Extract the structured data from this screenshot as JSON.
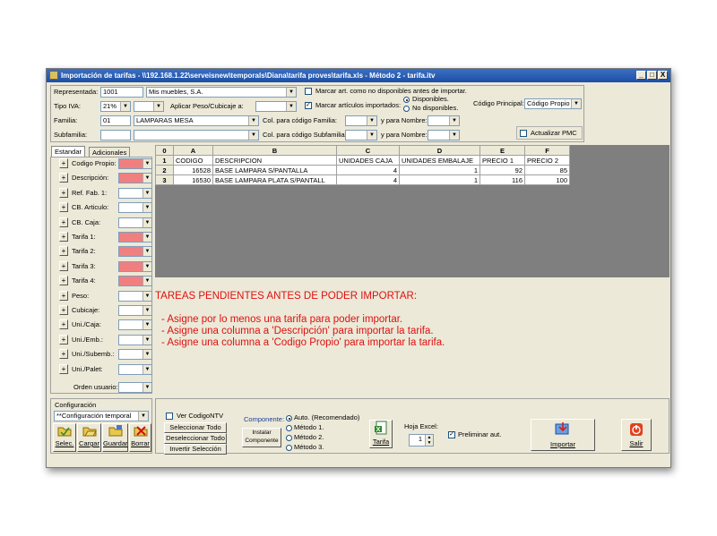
{
  "window": {
    "title": "Importación de tarifas - \\\\192.168.1.22\\serveisnew\\temporals\\Diana\\tarifa proves\\tarifa.xls - Método 2 - tarifa.itv",
    "min": "_",
    "max": "□",
    "close": "X"
  },
  "header": {
    "representada_label": "Representada:",
    "representada_code": "1001",
    "representada_name": "Mis muebles, S.A.",
    "tipo_iva_label": "Tipo IVA:",
    "tipo_iva_value": "21%",
    "aplicar_label": "Aplicar Peso/Cubicaje a:",
    "familia_label": "Familia:",
    "familia_code": "01",
    "familia_name": "LAMPARAS MESA",
    "subfamilia_label": "Subfamilia:",
    "col_codigo_familia_label": "Col. para código Familia:",
    "col_codigo_subfamilia_label": "Col. para código Subfamilia:",
    "y_para_nombre_1": "y para Nombre:",
    "y_para_nombre_2": "y para Nombre:",
    "marcar_no_disp_label": "Marcar art. como no disponibles antes de importar.",
    "marcar_importados_label": "Marcar artículos importados:",
    "disponibles_label": "Disponibles.",
    "no_disponibles_label": "No disponibles.",
    "codigo_principal_label": "Código Principal:",
    "codigo_principal_value": "Código Propio",
    "actualizar_pmc_label": "Actualizar PMC"
  },
  "tabs": [
    "Estandar",
    "Adicionales"
  ],
  "fields": [
    {
      "label": "Codigo Propio:",
      "pink": true
    },
    {
      "label": "Descripción:",
      "pink": true
    },
    {
      "label": "Ref. Fab. 1:",
      "pink": false
    },
    {
      "label": "CB. Articulo:",
      "pink": false
    },
    {
      "label": "CB. Caja:",
      "pink": false
    },
    {
      "label": "Tarifa 1:",
      "pink": true
    },
    {
      "label": "Tarifa 2:",
      "pink": true
    },
    {
      "label": "Tarifa 3:",
      "pink": true
    },
    {
      "label": "Tarifa 4:",
      "pink": true
    },
    {
      "label": "Peso:",
      "pink": false
    },
    {
      "label": "Cubicaje:",
      "pink": false
    },
    {
      "label": "Uni./Caja:",
      "pink": false
    },
    {
      "label": "Uni./Emb.:",
      "pink": false
    },
    {
      "label": "Uni./Subemb.:",
      "pink": false
    },
    {
      "label": "Uni./Palet:",
      "pink": false
    }
  ],
  "orden_usuario_label": "Orden usuario:",
  "sheet": {
    "corner": "0",
    "columns": [
      "A",
      "B",
      "C",
      "D",
      "E",
      "F"
    ],
    "rows": [
      {
        "n": "1",
        "cells": [
          "CODIGO",
          "DESCRIPCION",
          "UNIDADES CAJA",
          "UNIDADES EMBALAJE",
          "PRECIO 1",
          "PRECIO 2"
        ]
      },
      {
        "n": "2",
        "cells": [
          "16528",
          "BASE LAMPARA S/PANTALLA",
          "4",
          "1",
          "92",
          "85"
        ]
      },
      {
        "n": "3",
        "cells": [
          "16530",
          "BASE LAMPARA PLATA S/PANTALL",
          "4",
          "1",
          "116",
          "100"
        ]
      }
    ]
  },
  "messages": {
    "title": "TAREAS PENDIENTES ANTES DE PODER IMPORTAR:",
    "items": [
      "- Asigne por lo menos una tarifa para poder importar.",
      "- Asigne una columna a 'Descripción' para importar la tarifa.",
      "- Asigne una columna a 'Codigo Propio' para importar la tarifa."
    ]
  },
  "config": {
    "label": "Configuración",
    "value": "**Configuración temporal",
    "buttons": [
      "Selec.",
      "Cargar",
      "Guardar",
      "Borrar"
    ]
  },
  "bottom": {
    "ver_codigo_label": "Ver CodigoNTV",
    "seleccionar_todo": "Seleccionar Todo",
    "deseleccionar_todo": "Deseleccionar Todo",
    "invertir_seleccion": "Invertir Selección",
    "componente_label": "Componente:",
    "instalar_componente": "Instalar Componente",
    "metodos": [
      "Auto. (Recomendado)",
      "Método 1.",
      "Método 2.",
      "Método 3."
    ],
    "tarifa_button": "Tarifa",
    "hoja_excel_label": "Hoja Excel:",
    "hoja_excel_value": "1",
    "preliminar_label": "Preliminar aut.",
    "importar_button": "Importar",
    "salir_button": "Salir"
  }
}
